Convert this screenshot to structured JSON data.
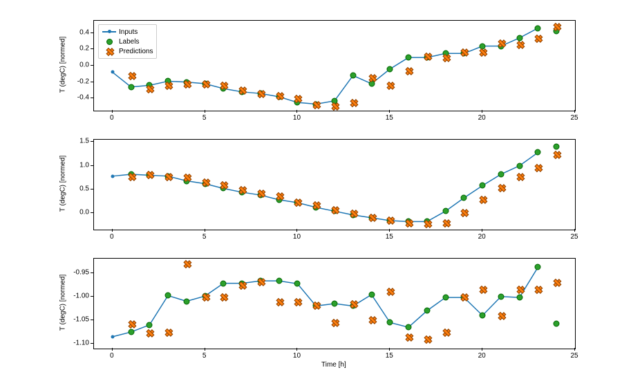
{
  "ylabel": "T (degC) [normed]",
  "xlabel": "Time [h]",
  "legend": {
    "inputs": "Inputs",
    "labels": "Labels",
    "predictions": "Predictions"
  },
  "chart_data": [
    {
      "type": "scatter",
      "ylabel": "T (degC) [normed]",
      "xlabel": "",
      "xlim": [
        -1,
        25
      ],
      "ylim": [
        -0.55,
        0.55
      ],
      "xticks": [
        0,
        5,
        10,
        15,
        20,
        25
      ],
      "yticks": [
        -0.4,
        -0.2,
        0.0,
        0.2,
        0.4
      ],
      "x": [
        0,
        1,
        2,
        3,
        4,
        5,
        6,
        7,
        8,
        9,
        10,
        11,
        12,
        13,
        14,
        15,
        16,
        17,
        18,
        19,
        20,
        21,
        22,
        23
      ],
      "inputs": [
        -0.08,
        -0.26,
        -0.24,
        -0.19,
        -0.2,
        -0.22,
        -0.28,
        -0.32,
        -0.34,
        -0.38,
        -0.45,
        -0.47,
        -0.43,
        -0.12,
        -0.22,
        -0.04,
        0.1,
        0.1,
        0.15,
        0.15,
        0.24,
        0.24,
        0.34,
        0.46
      ],
      "series": [
        {
          "name": "Labels",
          "x": [
            1,
            2,
            3,
            4,
            5,
            6,
            7,
            8,
            9,
            10,
            11,
            12,
            13,
            14,
            15,
            16,
            17,
            18,
            19,
            20,
            21,
            22,
            23,
            24
          ],
          "y": [
            -0.26,
            -0.24,
            -0.19,
            -0.2,
            -0.22,
            -0.28,
            -0.32,
            -0.34,
            -0.38,
            -0.45,
            -0.47,
            -0.43,
            -0.12,
            -0.22,
            -0.04,
            0.1,
            0.1,
            0.15,
            0.15,
            0.24,
            0.24,
            0.34,
            0.46,
            0.42
          ]
        },
        {
          "name": "Predictions",
          "x": [
            1,
            2,
            3,
            4,
            5,
            6,
            7,
            8,
            9,
            10,
            11,
            12,
            13,
            14,
            15,
            16,
            17,
            18,
            19,
            20,
            21,
            22,
            23,
            24
          ],
          "y": [
            -0.12,
            -0.28,
            -0.24,
            -0.22,
            -0.22,
            -0.24,
            -0.3,
            -0.34,
            -0.36,
            -0.4,
            -0.47,
            -0.49,
            -0.45,
            -0.14,
            -0.24,
            -0.06,
            0.12,
            0.1,
            0.17,
            0.17,
            0.28,
            0.26,
            0.34,
            0.48
          ]
        }
      ]
    },
    {
      "type": "scatter",
      "ylabel": "T (degC) [normed]",
      "xlabel": "",
      "xlim": [
        -1,
        25
      ],
      "ylim": [
        -0.35,
        1.55
      ],
      "xticks": [
        0,
        5,
        10,
        15,
        20,
        25
      ],
      "yticks": [
        0.0,
        0.5,
        1.0,
        1.5
      ],
      "x": [
        0,
        1,
        2,
        3,
        4,
        5,
        6,
        7,
        8,
        9,
        10,
        11,
        12,
        13,
        14,
        15,
        16,
        17,
        18,
        19,
        20,
        21,
        22,
        23
      ],
      "inputs": [
        0.78,
        0.82,
        0.8,
        0.78,
        0.68,
        0.62,
        0.52,
        0.44,
        0.38,
        0.28,
        0.22,
        0.12,
        0.04,
        -0.04,
        -0.1,
        -0.16,
        -0.18,
        -0.18,
        0.04,
        0.32,
        0.58,
        0.82,
        1.0,
        1.28
      ],
      "series": [
        {
          "name": "Labels",
          "x": [
            1,
            2,
            3,
            4,
            5,
            6,
            7,
            8,
            9,
            10,
            11,
            12,
            13,
            14,
            15,
            16,
            17,
            18,
            19,
            20,
            21,
            22,
            23,
            24
          ],
          "y": [
            0.82,
            0.8,
            0.78,
            0.68,
            0.62,
            0.52,
            0.44,
            0.38,
            0.28,
            0.22,
            0.12,
            0.04,
            -0.04,
            -0.1,
            -0.16,
            -0.18,
            -0.18,
            0.04,
            0.32,
            0.58,
            0.82,
            1.0,
            1.28,
            1.4
          ]
        },
        {
          "name": "Predictions",
          "x": [
            1,
            2,
            3,
            4,
            5,
            6,
            7,
            8,
            9,
            10,
            11,
            12,
            13,
            14,
            15,
            16,
            17,
            18,
            19,
            20,
            21,
            22,
            23,
            24
          ],
          "y": [
            0.78,
            0.82,
            0.78,
            0.76,
            0.66,
            0.6,
            0.5,
            0.42,
            0.36,
            0.24,
            0.18,
            0.08,
            0.0,
            -0.08,
            -0.14,
            -0.2,
            -0.22,
            -0.2,
            0.02,
            0.3,
            0.54,
            0.78,
            0.96,
            1.24
          ]
        }
      ]
    },
    {
      "type": "scatter",
      "ylabel": "T (degC) [normed]",
      "xlabel": "Time [h]",
      "xlim": [
        -1,
        25
      ],
      "ylim": [
        -1.11,
        -0.92
      ],
      "xticks": [
        0,
        5,
        10,
        15,
        20,
        25
      ],
      "yticks": [
        -1.1,
        -1.05,
        -1.0,
        -0.95
      ],
      "x": [
        0,
        1,
        2,
        3,
        4,
        5,
        6,
        7,
        8,
        9,
        10,
        11,
        12,
        13,
        14,
        15,
        16,
        17,
        18,
        19,
        20,
        21,
        22,
        23
      ],
      "inputs": [
        -1.085,
        -1.075,
        -1.06,
        -0.998,
        -1.01,
        -0.999,
        -0.972,
        -0.972,
        -0.967,
        -0.967,
        -0.973,
        -1.02,
        -1.015,
        -1.02,
        -0.996,
        -1.055,
        -1.065,
        -1.03,
        -1.002,
        -1.002,
        -1.04,
        -1.0,
        -1.002,
        -0.938
      ],
      "series": [
        {
          "name": "Labels",
          "x": [
            1,
            2,
            3,
            4,
            5,
            6,
            7,
            8,
            9,
            10,
            11,
            12,
            13,
            14,
            15,
            16,
            17,
            18,
            19,
            20,
            21,
            22,
            23,
            24
          ],
          "y": [
            -1.075,
            -1.06,
            -0.998,
            -1.01,
            -0.999,
            -0.972,
            -0.972,
            -0.967,
            -0.967,
            -0.973,
            -1.02,
            -1.015,
            -1.02,
            -0.996,
            -1.055,
            -1.065,
            -1.03,
            -1.002,
            -1.002,
            -1.04,
            -1.0,
            -1.002,
            -0.938,
            -1.058
          ]
        },
        {
          "name": "Predictions",
          "x": [
            1,
            2,
            3,
            4,
            5,
            6,
            7,
            8,
            9,
            10,
            11,
            12,
            13,
            14,
            15,
            16,
            17,
            18,
            19,
            20,
            21,
            22,
            23,
            24
          ],
          "y": [
            -1.058,
            -1.076,
            -1.075,
            -0.93,
            -1.0,
            -1.0,
            -0.975,
            -0.968,
            -1.01,
            -1.01,
            -1.018,
            -1.055,
            -1.015,
            -1.048,
            -0.988,
            -1.085,
            -1.09,
            -1.075,
            -1.0,
            -0.985,
            -1.04,
            -0.985,
            -0.985,
            -0.97
          ]
        }
      ]
    }
  ]
}
